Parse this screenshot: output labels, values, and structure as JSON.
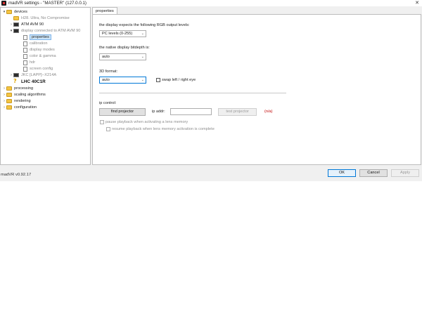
{
  "window": {
    "title": "madVR settings - \"MASTER\" (127.0.0.1)",
    "close_glyph": "✕"
  },
  "tree": {
    "items": [
      {
        "label": "devices",
        "toggle": "▾",
        "icon": "folder-icon",
        "state": "normal"
      },
      {
        "label": "H28. Ultra, No Compromise",
        "toggle": "",
        "icon": "folder-icon",
        "state": "dim"
      },
      {
        "label": "ATM AVM 90",
        "toggle": "›",
        "icon": "monitor-icon",
        "state": "normal"
      },
      {
        "label": "display connected to ATM AVM 90",
        "toggle": "▾",
        "icon": "monitor-icon",
        "state": "dim"
      },
      {
        "label": "properties",
        "toggle": "",
        "icon": "document-icon",
        "state": "selected"
      },
      {
        "label": "calibration",
        "toggle": "",
        "icon": "document-icon",
        "state": "dim"
      },
      {
        "label": "display modes",
        "toggle": "",
        "icon": "document-icon",
        "state": "dim"
      },
      {
        "label": "color & gamma",
        "toggle": "",
        "icon": "document-icon",
        "state": "dim"
      },
      {
        "label": "hdr",
        "toggle": "",
        "icon": "document-icon",
        "state": "dim"
      },
      {
        "label": "screen config",
        "toggle": "",
        "icon": "document-icon",
        "state": "dim"
      },
      {
        "label": "JKC [LAPP]--X214A",
        "toggle": "›",
        "icon": "monitor-icon",
        "state": "dim"
      },
      {
        "label": "LHC 40C1R",
        "toggle": "",
        "icon": "question-icon",
        "state": "bold"
      },
      {
        "label": "processing",
        "toggle": "›",
        "icon": "folder-icon",
        "state": "normal"
      },
      {
        "label": "scaling algorithms",
        "toggle": "›",
        "icon": "folder-icon",
        "state": "normal"
      },
      {
        "label": "rendering",
        "toggle": "›",
        "icon": "folder-icon",
        "state": "normal"
      },
      {
        "label": "configuration",
        "toggle": "›",
        "icon": "folder-icon",
        "state": "normal"
      }
    ]
  },
  "version": "madVR v0.92.17",
  "tab": {
    "label": "properties"
  },
  "properties": {
    "rgb_levels_label": "the display expects the following RGB output levels:",
    "rgb_levels_value": "PC levels (0-255)",
    "bitdepth_label": "the native display bitdepth is:",
    "bitdepth_value": "auto",
    "format3d_label": "3D format:",
    "format3d_value": "auto",
    "swap_eye_label": "swap left / right eye",
    "swap_eye_checked": false,
    "ip_control_label": "ip control:",
    "find_projector_label": "find projector",
    "ip_addr_label": "ip addr:",
    "ip_addr_value": "",
    "test_projector_label": "test projector",
    "status_text": "(n/a)",
    "pause_label": "pause playback when activating a lens memory",
    "resume_label": "resume playback when lens memory activation is complete"
  },
  "footer": {
    "ok_label": "OK",
    "cancel_label": "Cancel",
    "apply_label": "Apply"
  },
  "colors": {
    "accent": "#0078d7",
    "status_na": "#c00000",
    "selection": "#cce4f7"
  }
}
